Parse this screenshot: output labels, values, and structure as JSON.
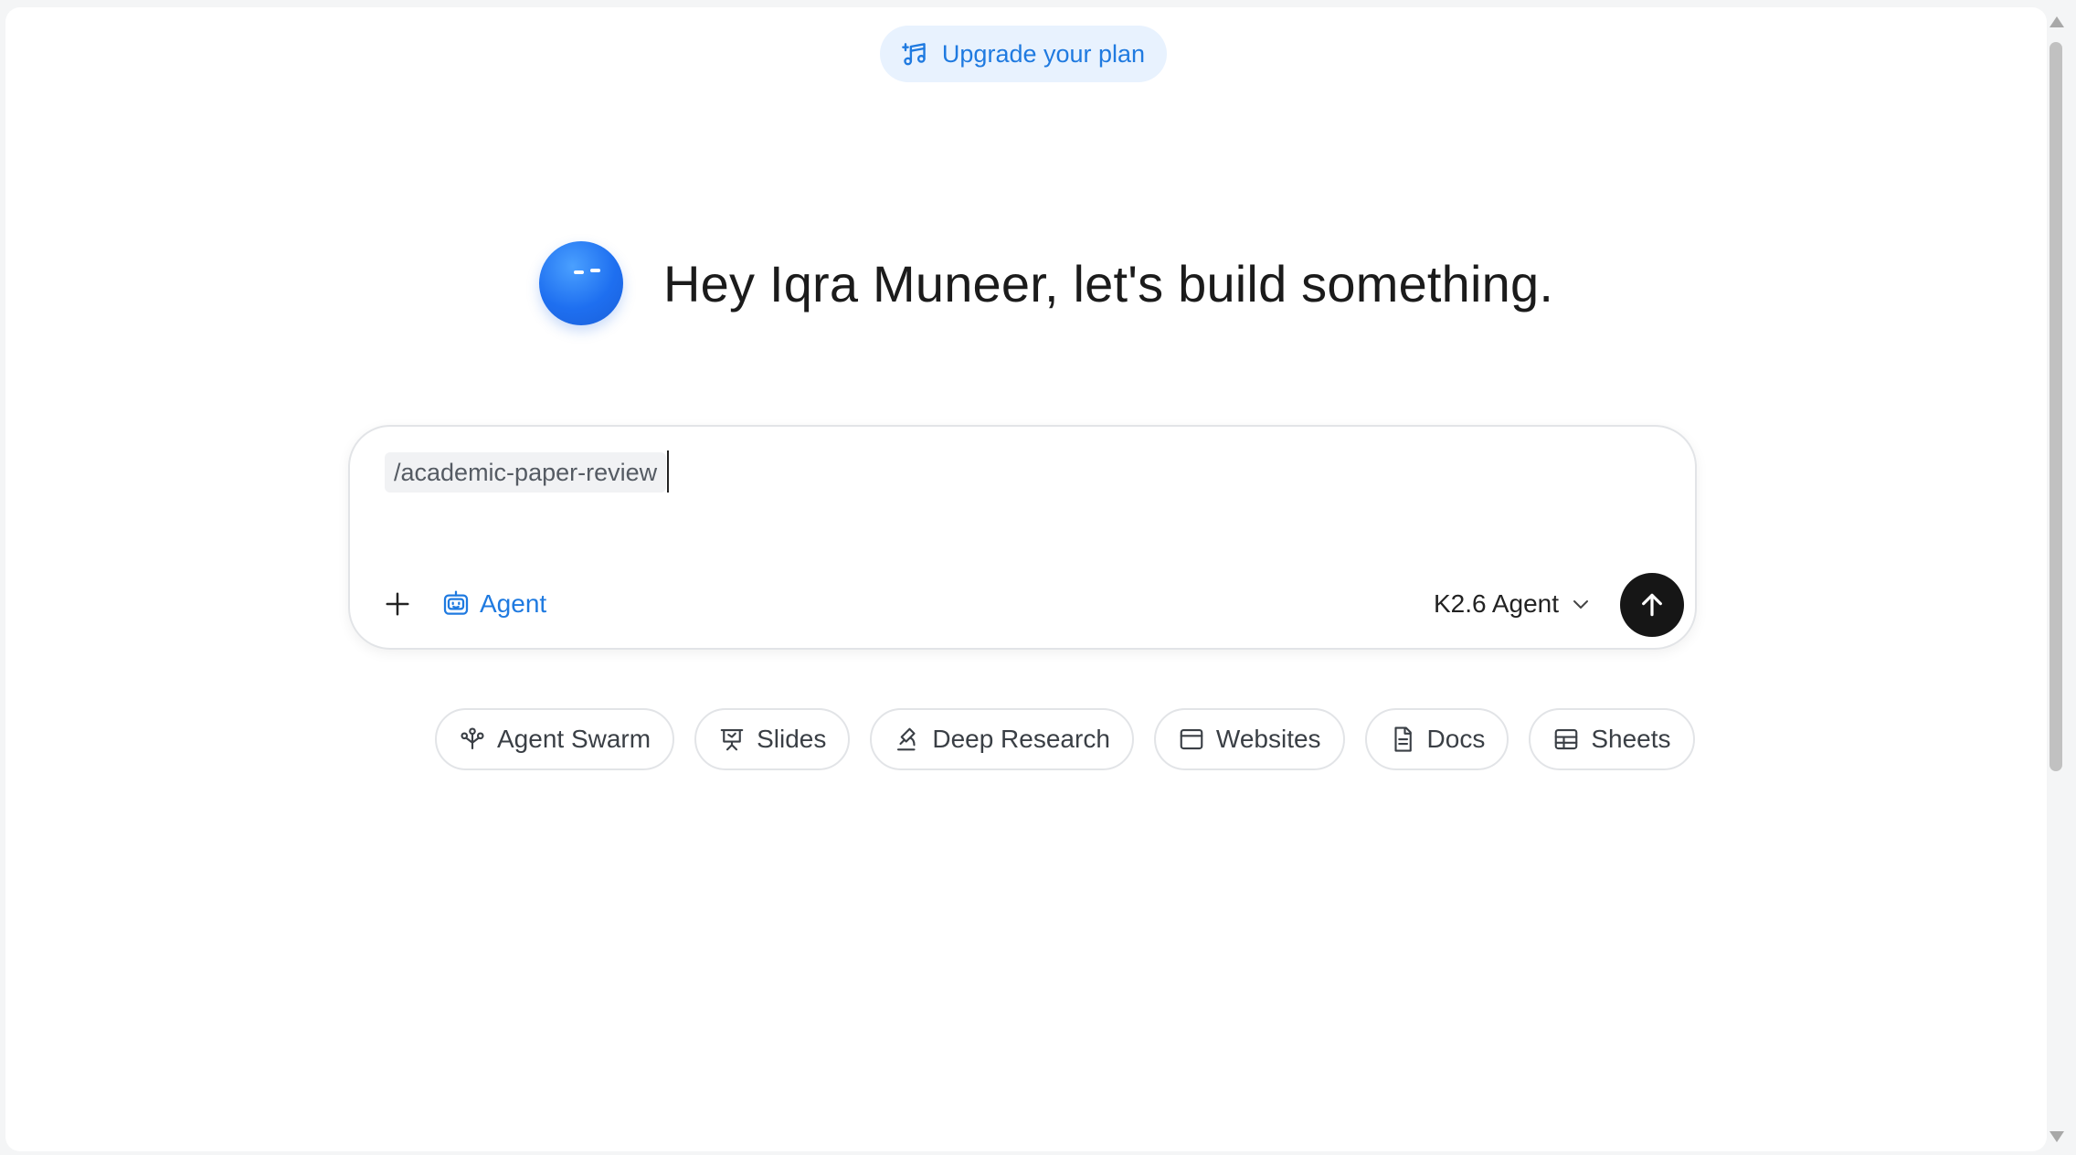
{
  "header": {
    "upgrade_label": "Upgrade your plan"
  },
  "greeting": {
    "text": "Hey Iqra Muneer, let's build something."
  },
  "composer": {
    "command_chip": "/academic-paper-review",
    "agent_label": "Agent",
    "model_label": "K2.6 Agent"
  },
  "chips": [
    {
      "label": "Agent Swarm",
      "icon": "agent-swarm-icon"
    },
    {
      "label": "Slides",
      "icon": "slides-icon"
    },
    {
      "label": "Deep Research",
      "icon": "deep-research-icon"
    },
    {
      "label": "Websites",
      "icon": "websites-icon"
    },
    {
      "label": "Docs",
      "icon": "docs-icon"
    },
    {
      "label": "Sheets",
      "icon": "sheets-icon"
    }
  ],
  "colors": {
    "accent": "#1f7ae0",
    "send_button": "#161616",
    "upgrade_bg": "#e8f2fe"
  }
}
